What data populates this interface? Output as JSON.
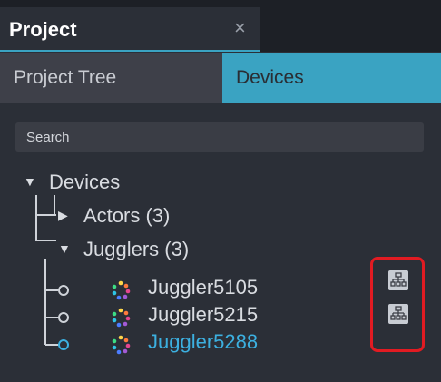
{
  "window": {
    "title": "Project",
    "close_glyph": "×"
  },
  "tabs": [
    {
      "label": "Project Tree",
      "active": false
    },
    {
      "label": "Devices",
      "active": true
    }
  ],
  "search": {
    "placeholder": "Search",
    "value": ""
  },
  "tree": {
    "root": {
      "label": "Devices",
      "expanded": true
    },
    "groups": [
      {
        "label": "Actors (3)",
        "expanded": false
      },
      {
        "label": "Jugglers (3)",
        "expanded": true,
        "devices": [
          {
            "label": "Juggler5105",
            "selected": false,
            "action_icon": "network-icon"
          },
          {
            "label": "Juggler5215",
            "selected": false,
            "action_icon": "network-icon"
          },
          {
            "label": "Juggler5288",
            "selected": true
          }
        ]
      }
    ]
  },
  "colors": {
    "accent": "#3aa3c2",
    "selected_text": "#3cb0e0",
    "highlight": "#e11b22",
    "background": "#2b2f37"
  }
}
